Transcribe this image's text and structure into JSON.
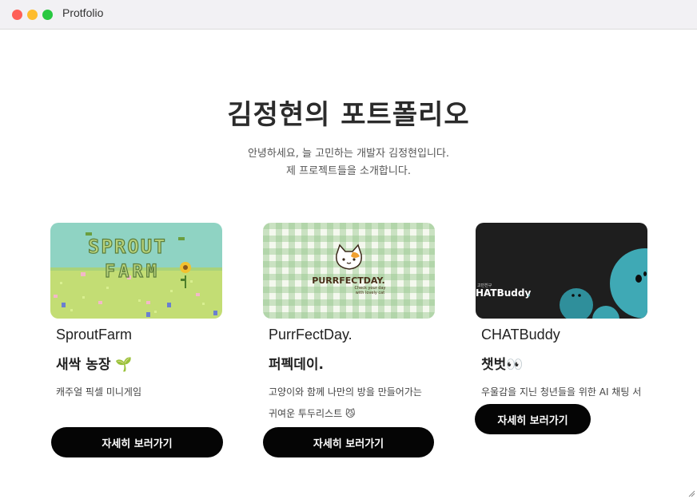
{
  "window": {
    "title": "Protfolio"
  },
  "hero": {
    "title": "김정현의 포트폴리오",
    "intro_line1": "안녕하세요, 늘 고민하는 개발자 김정현입니다.",
    "intro_line2": "제 프로젝트들을 소개합니다."
  },
  "projects": [
    {
      "name": "SproutFarm",
      "korean_name": "새싹 농장",
      "emoji": "🌱",
      "description": "캐주얼 픽셀 미니게임",
      "button_label": "자세히 보러가기",
      "thumb_text_1": "SPROUT",
      "thumb_text_2": "FARM"
    },
    {
      "name": "PurrFectDay.",
      "korean_name": "퍼펙데이.",
      "emoji": "",
      "description_line1": "고양이와 함께 나만의 방을 만들어가는",
      "description_line2": "귀여운 투두리스트",
      "description_emoji": "😼",
      "button_label": "자세히 보러가기",
      "thumb_title": "PURRFECTDAY.",
      "thumb_sub1": "Check your day",
      "thumb_sub2": "with lovely cat"
    },
    {
      "name": "CHATBuddy",
      "korean_name": "챗벗",
      "emoji": "👀",
      "description": "우울감을 지닌 청년들을 위한 AI 채팅 서",
      "button_label": "자세히 보러가기",
      "thumb_small": "고민친구",
      "thumb_title": "HATBuddy"
    }
  ]
}
